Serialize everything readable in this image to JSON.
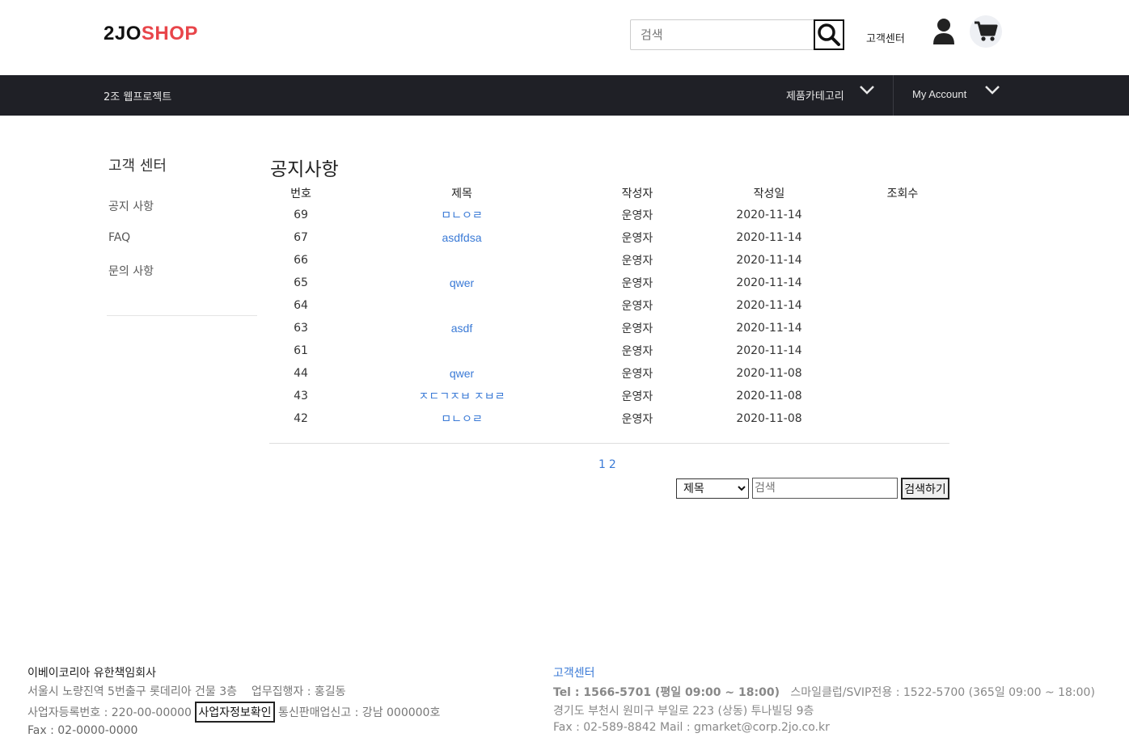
{
  "header": {
    "logo_part1": "2JO",
    "logo_part2": "SHOP",
    "search_placeholder": "검색",
    "cs_link": "고객센터",
    "brand_color": "#e8454a"
  },
  "navbar": {
    "title": "2조 웹프로젝트",
    "category_label": "제품카테고리",
    "account_label": "My Account"
  },
  "sidebar": {
    "title": "고객 센터",
    "items": [
      {
        "label": "공지 사항"
      },
      {
        "label": "FAQ"
      },
      {
        "label": "문의 사항"
      }
    ]
  },
  "main": {
    "title": "공지사항",
    "columns": [
      "번호",
      "제목",
      "작성자",
      "작성일",
      "조회수"
    ],
    "rows": [
      {
        "no": "69",
        "title": "ㅁㄴㅇㄹ",
        "writer": "운영자",
        "date": "2020-11-14",
        "views": ""
      },
      {
        "no": "67",
        "title": "asdfdsa",
        "writer": "운영자",
        "date": "2020-11-14",
        "views": ""
      },
      {
        "no": "66",
        "title": "",
        "writer": "운영자",
        "date": "2020-11-14",
        "views": ""
      },
      {
        "no": "65",
        "title": "qwer",
        "writer": "운영자",
        "date": "2020-11-14",
        "views": ""
      },
      {
        "no": "64",
        "title": "",
        "writer": "운영자",
        "date": "2020-11-14",
        "views": ""
      },
      {
        "no": "63",
        "title": "asdf",
        "writer": "운영자",
        "date": "2020-11-14",
        "views": ""
      },
      {
        "no": "61",
        "title": "",
        "writer": "운영자",
        "date": "2020-11-14",
        "views": ""
      },
      {
        "no": "44",
        "title": "qwer",
        "writer": "운영자",
        "date": "2020-11-08",
        "views": ""
      },
      {
        "no": "43",
        "title": "ㅈㄷㄱㅈㅂ ㅈㅂㄹ",
        "writer": "운영자",
        "date": "2020-11-08",
        "views": ""
      },
      {
        "no": "42",
        "title": "ㅁㄴㅇㄹ",
        "writer": "운영자",
        "date": "2020-11-08",
        "views": ""
      }
    ],
    "pages": [
      "1",
      "2"
    ],
    "search": {
      "select_value": "제목",
      "select_options": [
        "제목"
      ],
      "input_placeholder": "검색",
      "button_label": "검색하기"
    }
  },
  "footer": {
    "left": {
      "company": "이베이코리아 유한책임회사",
      "address": "서울시 노량진역 5번출구 롯데리아 건물 3층",
      "ceo": "업무집행자 : 홍길동",
      "biz_no": "사업자등록번호 : 220-00-00000",
      "biz_button": "사업자정보확인",
      "ecommerce": "통신판매업신고 : 강남 000000호",
      "fax": "Fax : 02-0000-0000"
    },
    "right": {
      "title": "고객센터",
      "tel": "Tel : 1566-5701 (평일 09:00 ~ 18:00)",
      "smile": "스마일클럽/SVIP전용 : 1522-5700 (365일 09:00 ~ 18:00)",
      "address": "경기도 부천시 원미구 부일로 223 (상동) 투나빌딩 9층",
      "fax_mail": "Fax : 02-589-8842   Mail : gmarket@corp.2jo.co.kr"
    }
  }
}
